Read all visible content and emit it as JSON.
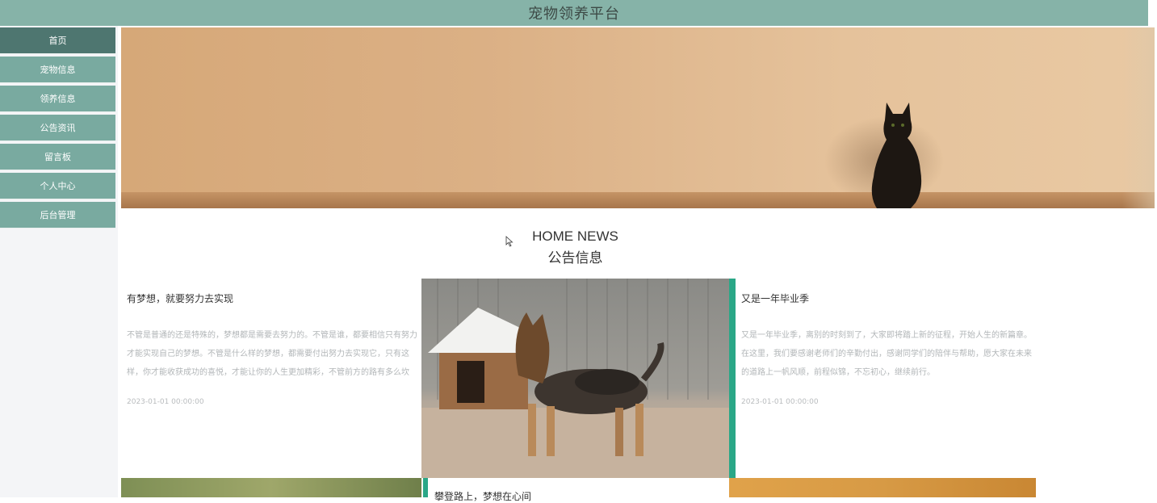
{
  "header": {
    "title": "宠物领养平台"
  },
  "sidebar": {
    "items": [
      {
        "label": "首页",
        "active": true
      },
      {
        "label": "宠物信息",
        "active": false
      },
      {
        "label": "领养信息",
        "active": false
      },
      {
        "label": "公告资讯",
        "active": false
      },
      {
        "label": "留言板",
        "active": false
      },
      {
        "label": "个人中心",
        "active": false
      },
      {
        "label": "后台管理",
        "active": false
      }
    ]
  },
  "section": {
    "title_en": "HOME NEWS",
    "title_cn": "公告信息"
  },
  "news": [
    {
      "headline": "有梦想，就要努力去实现",
      "summary": "不管是普通的还是特殊的，梦想都是需要去努力的。不管是谁，都要相信只有努力才能实现自己的梦想。不管是什么样的梦想，都需要付出努力去实现它，只有这样，你才能收获成功的喜悦，才能让你的人生更加精彩，不管前方的路有多么坎坷，都要勇敢地走下去，不管遇到什么困难。",
      "date": "2023-01-01 00:00:00"
    },
    {
      "headline": "又是一年毕业季",
      "summary": "又是一年毕业季，离别的时刻到了，大家即将踏上新的征程，开始人生的新篇章。在这里，我们要感谢老师们的辛勤付出，感谢同学们的陪伴与帮助，愿大家在未来的道路上一帆风顺，前程似锦，不忘初心，继续前行。",
      "date": "2023-01-01 00:00:00"
    }
  ],
  "bottom_row": {
    "headline": "攀登路上，梦想在心间"
  },
  "colors": {
    "header": "#86b3a8",
    "sidebar_item": "#79aaa0",
    "sidebar_active": "#4e7670",
    "accent": "#2aa787"
  }
}
